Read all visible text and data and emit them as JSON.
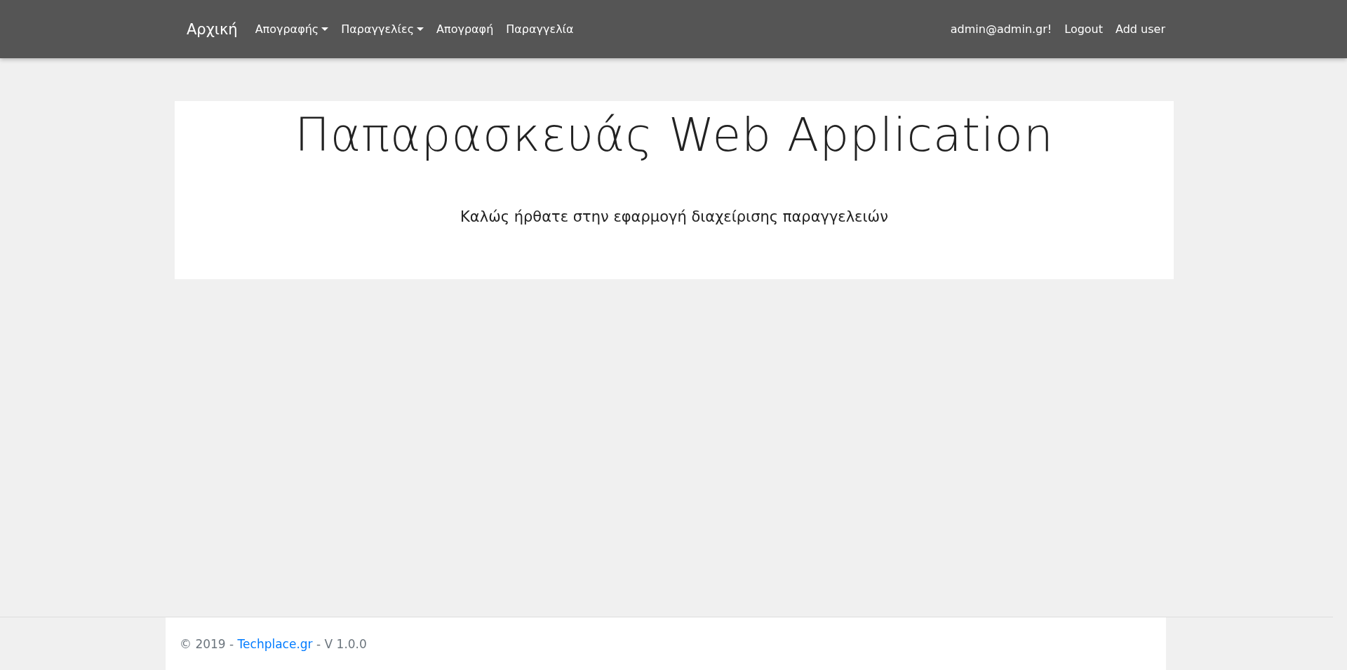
{
  "navbar": {
    "brand": "Αρχική",
    "items": [
      {
        "label": "Απογραφής",
        "dropdown": true
      },
      {
        "label": "Παραγγελίες",
        "dropdown": true
      },
      {
        "label": "Απογραφή",
        "dropdown": false
      },
      {
        "label": "Παραγγελία",
        "dropdown": false
      }
    ],
    "right_items": [
      "admin@admin.gr!",
      "Logout",
      "Add user"
    ]
  },
  "hero": {
    "title": "Παπαρασκευάς Web Application",
    "subtitle": "Καλώς ήρθατε στην εφαρμογή διαχείρισης παραγγελειών"
  },
  "footer": {
    "prefix": "© 2019 - ",
    "link": "Techplace.gr",
    "suffix": " - V 1.0.0"
  }
}
